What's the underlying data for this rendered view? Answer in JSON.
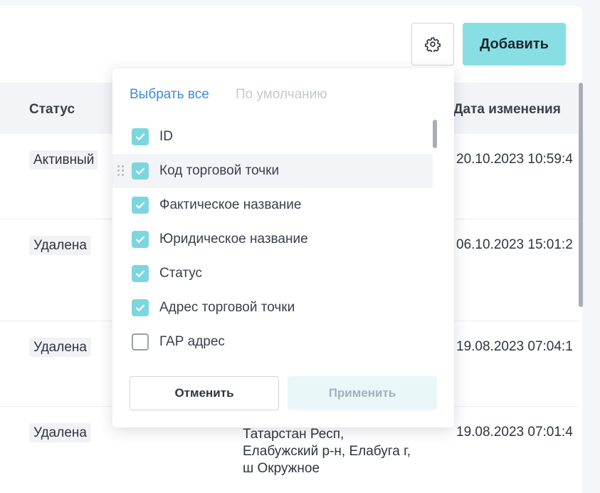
{
  "toolbar": {
    "settings_icon": "gear-icon",
    "add_label": "Добавить"
  },
  "table": {
    "columns": {
      "status": "Статус",
      "date": "Дата изменения"
    },
    "rows": [
      {
        "status": "Активный",
        "date": "20.10.2023 10:59:4"
      },
      {
        "status": "Удалена",
        "date": "06.10.2023 15:01:2"
      },
      {
        "status": "Удалена",
        "date": "19.08.2023 07:04:1"
      },
      {
        "status": "Удалена",
        "date": "19.08.2023 07:01:4",
        "address": "Татарстан Респ, Елабужский р-н, Елабуга г, ш Окружное"
      }
    ]
  },
  "column_settings": {
    "select_all": "Выбрать все",
    "default": "По умолчанию",
    "items": [
      {
        "label": "ID",
        "checked": true
      },
      {
        "label": "Код торговой точки",
        "checked": true
      },
      {
        "label": "Фактическое название",
        "checked": true
      },
      {
        "label": "Юридическое название",
        "checked": true
      },
      {
        "label": "Статус",
        "checked": true
      },
      {
        "label": "Адрес торговой точки",
        "checked": true
      },
      {
        "label": "ГАР адрес",
        "checked": false
      }
    ],
    "cancel": "Отменить",
    "apply": "Применить"
  },
  "colors": {
    "accent": "#87dfe3",
    "checkbox": "#7dd6df",
    "link": "#3d8bd8"
  }
}
